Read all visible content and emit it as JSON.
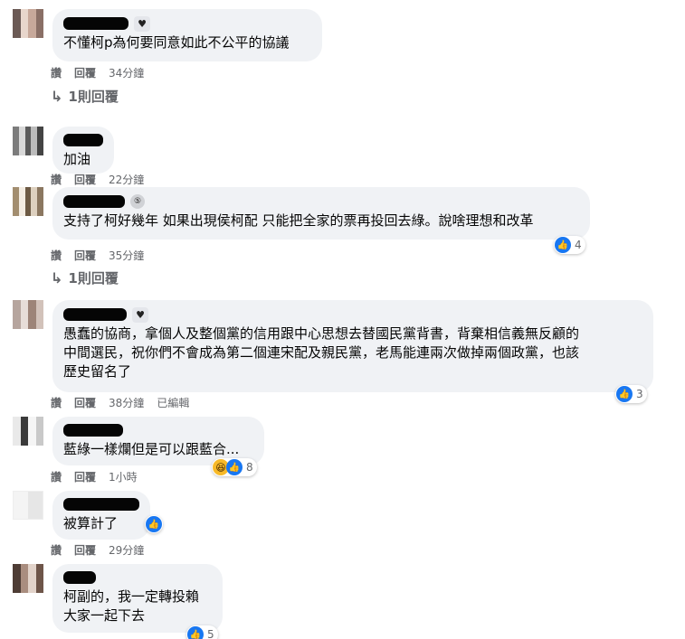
{
  "comments": [
    {
      "badge": "♥",
      "text": "不懂柯p為何要同意如此不公平的協議",
      "actions": [
        "讚",
        "回覆"
      ],
      "time": "34分鐘",
      "replies": "1則回覆"
    },
    {
      "text": "加油",
      "actions": [
        "讚",
        "回覆"
      ],
      "time": "22分鐘"
    },
    {
      "badge": "⑤",
      "text": "支持了柯好幾年 如果出現侯柯配 只能把全家的票再投回去綠。說啥理想和改革",
      "actions": [
        "讚",
        "回覆"
      ],
      "time": "35分鐘",
      "reactions": "4",
      "replies": "1則回覆"
    },
    {
      "badge": "♥",
      "text": "愚蠢的協商，拿個人及整個黨的信用跟中心思想去替國民黨背書，背棄相信義無反顧的\n中間選民，祝你們不會成為第二個連宋配及親民黨，老馬能連兩次做掉兩個政黨，也該\n歷史留名了",
      "actions": [
        "讚",
        "回覆"
      ],
      "time": "38分鐘",
      "edited": "已編輯",
      "reactions": "3"
    },
    {
      "text": "藍綠一樣爛但是可以跟藍合...",
      "actions": [
        "讚",
        "回覆"
      ],
      "time": "1小時",
      "reactions": "8"
    },
    {
      "text": "被算計了",
      "actions": [
        "讚",
        "回覆"
      ],
      "time": "29分鐘"
    },
    {
      "text": "柯副的，我一定轉投賴\n大家一起下去",
      "reactions": "5"
    }
  ],
  "icons": {
    "like": "thumbs-up-icon",
    "haha": "laughing-face-icon",
    "reply_arrow": "reply-arrow-icon"
  },
  "colors": {
    "bubble": "#f0f2f5",
    "like": "#1877f2",
    "meta": "#65676b"
  }
}
